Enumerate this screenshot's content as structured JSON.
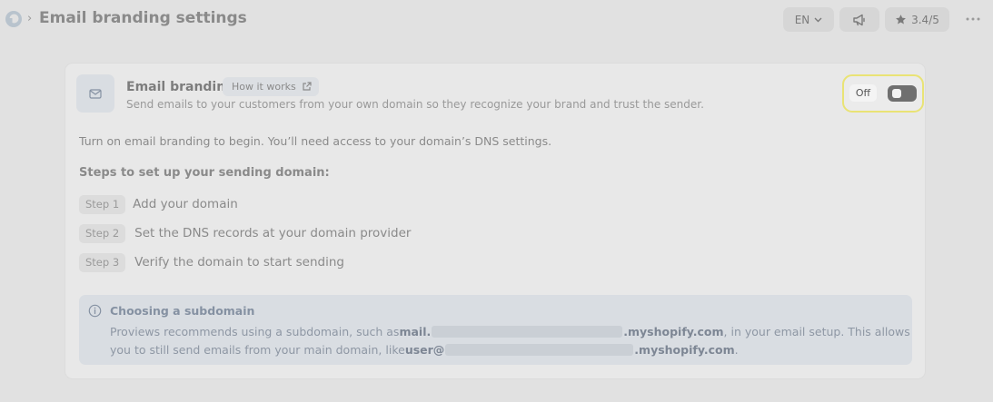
{
  "header": {
    "breadcrumb_sep": "›",
    "title": "Email branding settings",
    "language": "EN",
    "rating": "3.4/5"
  },
  "card": {
    "title": "Email branding",
    "how_it_works": "How it works",
    "description": "Send emails to your customers from your own domain so they recognize your brand and trust the sender.",
    "toggle_label": "Off",
    "toggle_enabled": false,
    "intro": "Turn on email branding to begin. You’ll need access to your domain’s DNS settings.",
    "steps_heading": "Steps to set up your sending domain:",
    "steps": [
      {
        "badge": "Step 1",
        "text": "Add your domain"
      },
      {
        "badge": "Step 2",
        "text": "Set the DNS records at your domain provider"
      },
      {
        "badge": "Step 3",
        "text": "Verify the domain to start sending"
      }
    ]
  },
  "callout": {
    "title": "Choosing a subdomain",
    "line1_a": "Proviews recommends using a subdomain, such as ",
    "line1_b": "mail.",
    "line1_c": ".myshopify.com",
    "line1_d": ", in your email setup. This allows",
    "line2_a": "you to still send emails from your main domain, like ",
    "line2_b": "user@",
    "line2_c": ".myshopify.com",
    "line2_d": "."
  },
  "colors": {
    "highlight_border": "#e9e375",
    "switch_off": "#6f6f6f",
    "callout_bg": "#d9dde2"
  }
}
